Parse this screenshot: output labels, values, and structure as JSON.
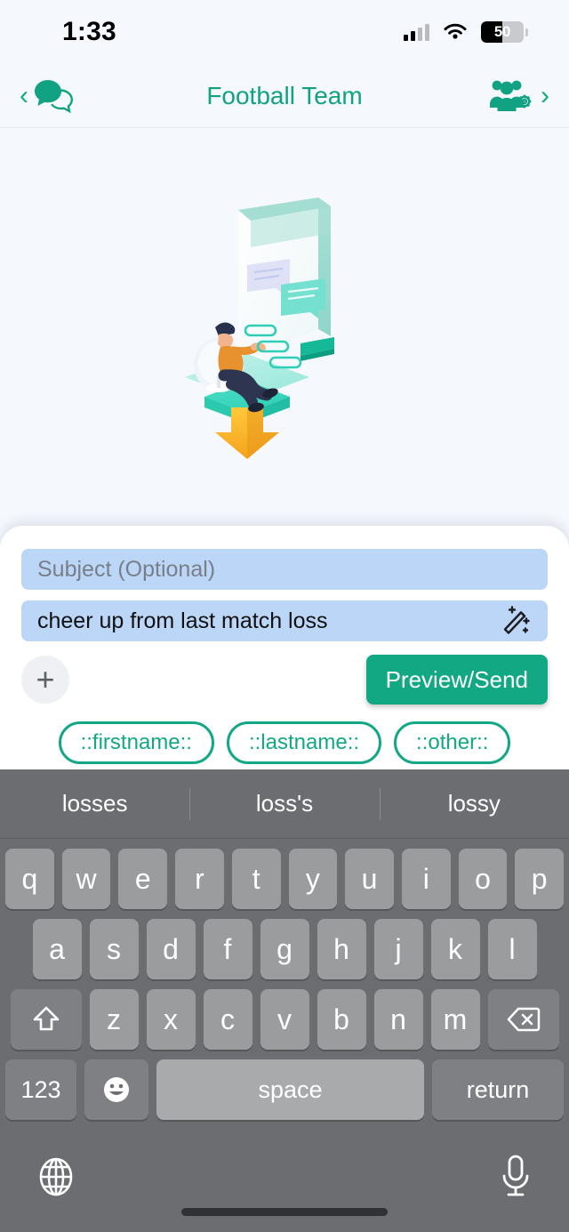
{
  "status_bar": {
    "time": "1:33",
    "signal_icon": "cellular-signal-icon",
    "wifi_icon": "wifi-icon",
    "battery_level": "50",
    "battery_icon": "battery-icon"
  },
  "nav_bar": {
    "back_chevron": "‹",
    "back_icon": "chat-bubbles-icon",
    "title": "Football Team",
    "group_icon": "group-settings-icon",
    "forward_chevron": "›",
    "accent_color": "#11a283"
  },
  "illustration": {
    "name": "person-messaging-illustration",
    "description": "isometric person on beanbag chair with chat screen and download arrow"
  },
  "composer": {
    "subject": {
      "value": "",
      "placeholder": "Subject (Optional)"
    },
    "message": {
      "value": "cheer up from last match loss",
      "placeholder": "",
      "assist_icon": "magic-wand-icon"
    },
    "attach_label": "+",
    "send_label": "Preview/Send",
    "send_color": "#13a884",
    "field_bg": "#bcd6f7",
    "merge_tags": [
      {
        "label": "::firstname::"
      },
      {
        "label": "::lastname::"
      },
      {
        "label": "::other::"
      }
    ]
  },
  "keyboard": {
    "suggestions": [
      "losses",
      "loss's",
      "lossy"
    ],
    "row1": [
      "q",
      "w",
      "e",
      "r",
      "t",
      "y",
      "u",
      "i",
      "o",
      "p"
    ],
    "row2": [
      "a",
      "s",
      "d",
      "f",
      "g",
      "h",
      "j",
      "k",
      "l"
    ],
    "row3": [
      "z",
      "x",
      "c",
      "v",
      "b",
      "n",
      "m"
    ],
    "shift_icon": "shift-up-arrow-icon",
    "backspace_icon": "backspace-delete-icon",
    "numeric_label": "123",
    "emoji_icon": "smiley-face-icon",
    "space_label": "space",
    "return_label": "return",
    "globe_icon": "globe-language-icon",
    "mic_icon": "microphone-icon",
    "background_color": "#6b6d70"
  }
}
